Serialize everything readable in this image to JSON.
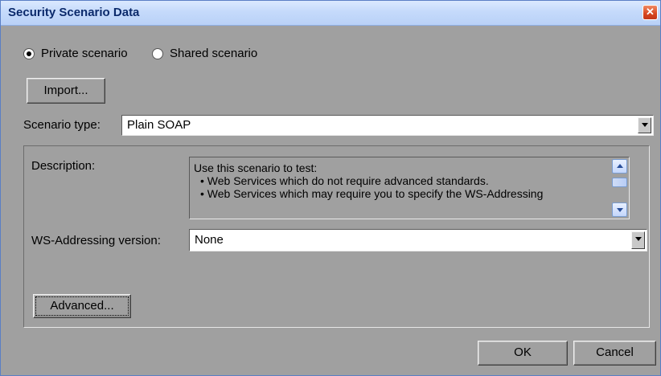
{
  "window": {
    "title": "Security Scenario Data",
    "close_glyph": "✕"
  },
  "scope": {
    "private_label": "Private scenario",
    "shared_label": "Shared scenario",
    "selected": "private"
  },
  "import_label": "Import...",
  "scenario_type": {
    "label": "Scenario type:",
    "value": "Plain SOAP"
  },
  "description": {
    "label": "Description:",
    "lines": [
      "Use this scenario to test:",
      "• Web Services which do not require advanced standards.",
      "• Web Services which may require you to specify the WS-Addressing"
    ]
  },
  "ws_addressing": {
    "label": "WS-Addressing version:",
    "value": "None"
  },
  "advanced_label": "Advanced...",
  "ok_label": "OK",
  "cancel_label": "Cancel",
  "icons": {
    "close": "close-icon",
    "dropdown": "chevron-down-icon",
    "scroll_up": "arrow-up-icon",
    "scroll_down": "arrow-down-icon"
  },
  "colors": {
    "dialog_background": "#a0a0a0",
    "titlebar": "#c5dafb",
    "title_text": "#0b2a6b",
    "close_button": "#d7461e"
  }
}
